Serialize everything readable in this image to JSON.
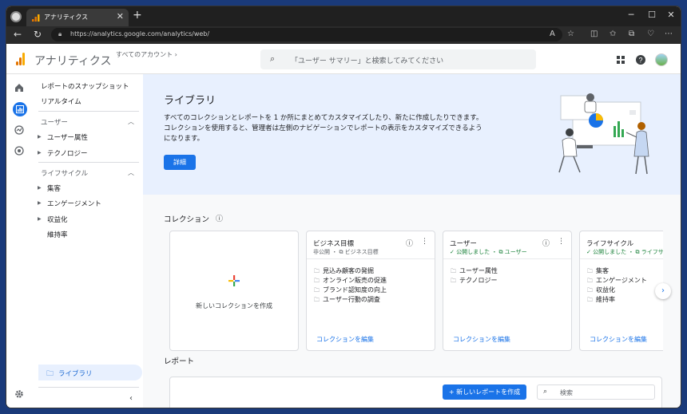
{
  "browser": {
    "tab_title": "アナリティクス",
    "tab_close": "✕",
    "new_tab": "+",
    "url": "https://analytics.google.com/analytics/web/",
    "window_controls": [
      "─",
      "☐",
      "✕"
    ]
  },
  "header": {
    "brand": "アナリティクス",
    "account_link": "すべてのアカウント",
    "search_placeholder": "「ユーザー サマリー」と検索してみてください",
    "brand_colors": [
      "#f9ab00",
      "#e37400",
      "#e37400"
    ]
  },
  "rail": {
    "icons": [
      "home-icon",
      "reports-icon",
      "explore-icon",
      "advertising-icon",
      "settings-icon"
    ]
  },
  "sidebar": {
    "snapshot": "レポートのスナップショット",
    "realtime": "リアルタイム",
    "user_section": "ユーザー",
    "user_items": [
      "ユーザー属性",
      "テクノロジー"
    ],
    "lifecycle_section": "ライフサイクル",
    "lifecycle_items": [
      "集客",
      "エンゲージメント",
      "収益化"
    ],
    "retention": "維持率",
    "library": "ライブラリ"
  },
  "hero": {
    "title": "ライブラリ",
    "description": "すべてのコレクションとレポートを 1 か所にまとめてカスタマイズしたり、新たに作成したりできます。コレクションを使用すると、管理者は左側のナビゲーションでレポートの表示をカスタマイズできるようになります。",
    "button": "詳細"
  },
  "collections": {
    "title": "コレクション",
    "new_card_label": "新しいコレクションを作成",
    "cards": [
      {
        "title": "ビジネス目標",
        "meta": "非公開 ・ ⧉ ビジネス目標",
        "published": false,
        "items": [
          "見込み顧客の発掘",
          "オンライン販売の促進",
          "ブランド認知度の向上",
          "ユーザー行動の調査"
        ],
        "edit": "コレクションを編集"
      },
      {
        "title": "ユーザー",
        "meta": "公開しました ・ ⧉ ユーザー",
        "published": true,
        "items": [
          "ユーザー属性",
          "テクノロジー"
        ],
        "edit": "コレクションを編集"
      },
      {
        "title": "ライフサイクル",
        "meta": "公開しました ・ ⧉ ライフサイ",
        "published": true,
        "items": [
          "集客",
          "エンゲージメント",
          "収益化",
          "維持率"
        ],
        "edit": "コレクションを編集"
      }
    ]
  },
  "reports": {
    "title": "レポート",
    "create_button": "新しいレポートを作成",
    "search_placeholder": "検索"
  }
}
